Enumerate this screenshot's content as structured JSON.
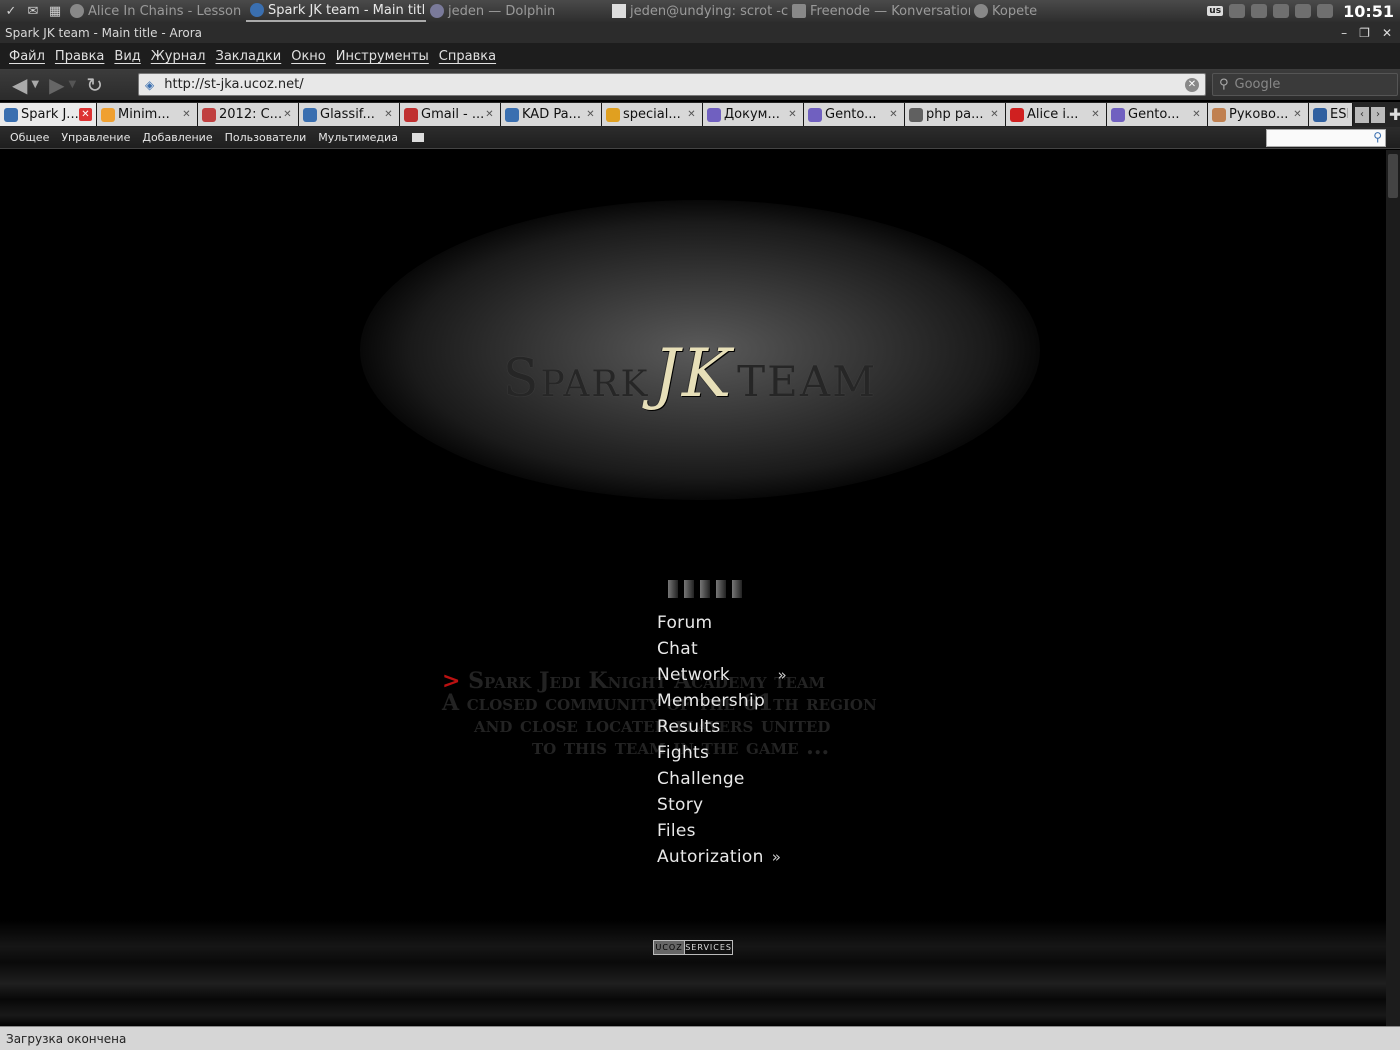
{
  "taskbar": {
    "tasks": [
      {
        "label": "Alice In Chains - Lesson Le"
      },
      {
        "label": "Spark JK team - Main title -"
      },
      {
        "label": "jeden — Dolphin"
      },
      {
        "label": "jeden@undying: scrot -cd"
      },
      {
        "label": "Freenode — Konversation"
      },
      {
        "label": "Kopete"
      }
    ],
    "keyboard_layout": "us",
    "clock": "10:51"
  },
  "window": {
    "title": "Spark JK team - Main title - Arora"
  },
  "menubar": {
    "items": [
      "Файл",
      "Правка",
      "Вид",
      "Журнал",
      "Закладки",
      "Окно",
      "Инструменты",
      "Справка"
    ]
  },
  "navbar": {
    "url": "http://st-jka.ucoz.net/",
    "search_placeholder": "Google"
  },
  "tabs": [
    {
      "label": "Spark J...",
      "color": "#3a6fb0"
    },
    {
      "label": "Minim...",
      "color": "#f0a030"
    },
    {
      "label": "2012: C...",
      "color": "#c04040"
    },
    {
      "label": "Glassif...",
      "color": "#3a6fb0"
    },
    {
      "label": "Gmail - ...",
      "color": "#c03030"
    },
    {
      "label": "KAD Pa...",
      "color": "#3a6fb0"
    },
    {
      "label": "special...",
      "color": "#e0a020"
    },
    {
      "label": "Докум...",
      "color": "#7060c0"
    },
    {
      "label": "Gento...",
      "color": "#7060c0"
    },
    {
      "label": "php pa...",
      "color": "#606060"
    },
    {
      "label": "Alice i...",
      "color": "#d02020"
    },
    {
      "label": "Gento...",
      "color": "#7060c0"
    },
    {
      "label": "Руково...",
      "color": "#c08050"
    },
    {
      "label": "ESL",
      "color": "#3060a0"
    }
  ],
  "adminbar": {
    "items": [
      "Общее",
      "Управление",
      "Добавление",
      "Пользователи",
      "Мультимедиа"
    ]
  },
  "page": {
    "logo": {
      "word1": "Spark",
      "mid": "JK",
      "word2": "TEAM"
    },
    "intro": {
      "arrow": ">",
      "line1": "Spark Jedi Knight Academy team",
      "line2": "A closed community of the 61th region",
      "line3": "and close located players united",
      "line4": "to this team in the game ..."
    },
    "menu": [
      {
        "label": "Forum",
        "sub": ""
      },
      {
        "label": "Chat",
        "sub": ""
      },
      {
        "label": "Network",
        "sub": "»"
      },
      {
        "label": "Membership",
        "sub": ""
      },
      {
        "label": "Results",
        "sub": ""
      },
      {
        "label": "Fights",
        "sub": ""
      },
      {
        "label": "Challenge",
        "sub": ""
      },
      {
        "label": "Story",
        "sub": ""
      },
      {
        "label": "Files",
        "sub": ""
      },
      {
        "label": "Autorization",
        "sub": "»"
      }
    ],
    "badge": {
      "left": "UCOZ",
      "right": "SERVICES"
    }
  },
  "statusbar": {
    "text": "Загрузка окончена"
  }
}
